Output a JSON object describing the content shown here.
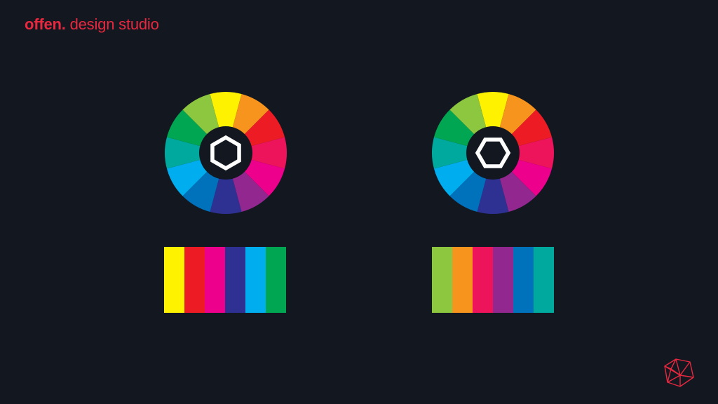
{
  "brand": {
    "bold": "offen.",
    "light": "design studio"
  },
  "colors": {
    "background": "#121720",
    "accent": "#e8283f",
    "hub": "#121720",
    "hexagon_stroke": "#ffffff"
  },
  "wheels": [
    {
      "name": "color-wheel-left",
      "center_icon": "hexagon-icon",
      "segments": [
        "#fff200",
        "#f7941d",
        "#ed1c24",
        "#ed145b",
        "#ec008c",
        "#92278f",
        "#2e3192",
        "#0072bc",
        "#00aeef",
        "#00a99d",
        "#00a651",
        "#8dc63f"
      ]
    },
    {
      "name": "color-wheel-right",
      "center_icon": "hexagon-icon",
      "segments": [
        "#fff200",
        "#f7941d",
        "#ed1c24",
        "#ed145b",
        "#ec008c",
        "#92278f",
        "#2e3192",
        "#0072bc",
        "#00aeef",
        "#00a99d",
        "#00a651",
        "#8dc63f"
      ]
    }
  ],
  "palettes": {
    "left": [
      "#fff200",
      "#ed1c24",
      "#ec008c",
      "#2e3192",
      "#00aeef",
      "#00a651"
    ],
    "right": [
      "#8dc63f",
      "#f7941d",
      "#ed145b",
      "#92278f",
      "#0072bc",
      "#00a99d"
    ]
  },
  "logo_icon": "polyhedron-logo-icon"
}
